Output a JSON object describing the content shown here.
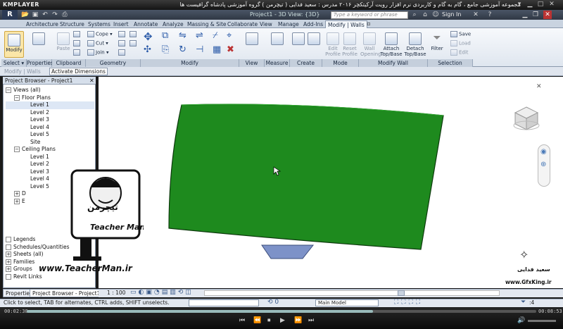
{
  "player": {
    "logo": "KMPLAYER",
    "title": "مجموعه آموزشی جامع ، گام به گام و کاربردی نرم افزار رویت آرکیتکچر ۲۰۱۶ مدرس : سعید فدایی ( تیچرمن ) گروه آموزشی پادشاه گرافیست ها",
    "time_elapsed": "00:02:38",
    "time_total": "00:08:53",
    "progress_fraction": 0.68
  },
  "revit": {
    "logo": "R",
    "project_title": "Project1 - 3D View: {3D}",
    "search_placeholder": "Type a keyword or phrase",
    "signin": "Sign In",
    "tabs": [
      "Architecture",
      "Structure",
      "Systems",
      "Insert",
      "Annotate",
      "Analyze",
      "Massing & Site",
      "Collaborate",
      "View",
      "Manage",
      "Add-Ins",
      "Modify | Walls"
    ],
    "active_tab": "Modify | Walls",
    "ribbon": {
      "select": {
        "label": "Select",
        "modify": "Modify"
      },
      "properties": {
        "label": "Properties",
        "btn": "Properties"
      },
      "clipboard": {
        "label": "Clipboard",
        "paste": "Paste",
        "cope": "Cope",
        "cut": "Cut",
        "join": "Join"
      },
      "geometry": {
        "label": "Geometry"
      },
      "modify": {
        "label": "Modify"
      },
      "view": {
        "label": "View"
      },
      "measure": {
        "label": "Measure"
      },
      "create": {
        "label": "Create"
      },
      "mode": {
        "label": "Mode",
        "edit_profile": "Edit Profile",
        "reset_profile": "Reset Profile"
      },
      "modify_wall": {
        "label": "Modify Wall",
        "wall_opening": "Wall Opening",
        "attach": "Attach Top/Base",
        "detach": "Detach Top/Base"
      },
      "selection": {
        "label": "Selection",
        "filter": "Filter",
        "save": "Save",
        "load": "Load",
        "edit": "Edit"
      }
    },
    "options_bar": {
      "context": "Modify | Walls",
      "active_dimensions": "Activate Dimensions"
    },
    "project_browser": {
      "title": "Project Browser - Project1",
      "items": [
        {
          "label": "Views (all)",
          "depth": 0,
          "toggle": "−"
        },
        {
          "label": "Floor Plans",
          "depth": 1,
          "toggle": "−"
        },
        {
          "label": "Level 1",
          "depth": 2,
          "selected": true
        },
        {
          "label": "Level 2",
          "depth": 2
        },
        {
          "label": "Level 3",
          "depth": 2
        },
        {
          "label": "Level 4",
          "depth": 2
        },
        {
          "label": "Level 5",
          "depth": 2
        },
        {
          "label": "Site",
          "depth": 2
        },
        {
          "label": "Ceiling Plans",
          "depth": 1,
          "toggle": "−"
        },
        {
          "label": "Level 1",
          "depth": 2
        },
        {
          "label": "Level 2",
          "depth": 2
        },
        {
          "label": "Level 3",
          "depth": 2
        },
        {
          "label": "Level 4",
          "depth": 2
        },
        {
          "label": "Level 5",
          "depth": 2
        },
        {
          "label": "D",
          "depth": 1,
          "toggle": "+"
        },
        {
          "label": "E",
          "depth": 1,
          "toggle": "+"
        }
      ],
      "lower_items": [
        {
          "label": "Legends",
          "toggle": ""
        },
        {
          "label": "Schedules/Quantities",
          "toggle": ""
        },
        {
          "label": "Sheets (all)",
          "toggle": "+"
        },
        {
          "label": "Families",
          "toggle": "+"
        },
        {
          "label": "Groups",
          "toggle": "+"
        },
        {
          "label": "Revit Links",
          "toggle": ""
        }
      ]
    },
    "bottom_tabs": [
      "Properties",
      "Project Browser - Project1"
    ],
    "view_scale": "1 : 100",
    "status": "Click to select, TAB for alternates, CTRL adds, SHIFT unselects.",
    "model_box": "Main Model",
    "filter_count": ":4"
  },
  "watermarks": {
    "teacherman_site": "www.TeacherMan.ir",
    "teacherman_name": "Teacher Man",
    "teacherman_fa": "تیچرمن",
    "gfxking_site": "www.GfxKing.ir",
    "gfxking_name": "سعید فدایی"
  },
  "colors": {
    "wall": "#1e8a1e",
    "wall_edge": "#0d3a0d",
    "ribbon_accent": "#2b3a55"
  }
}
